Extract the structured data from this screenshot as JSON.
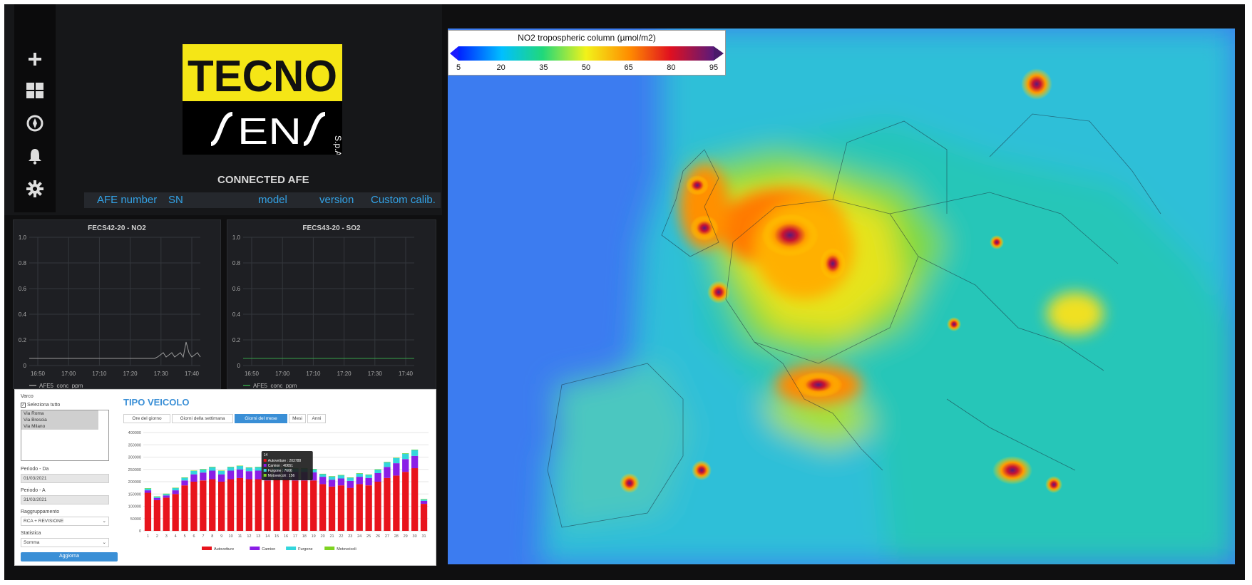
{
  "logo": {
    "line1": "TECNO",
    "line2": "SENS",
    "suffix": "S.p.A"
  },
  "sidebar": {
    "icons": [
      "plus-icon",
      "dashboard-icon",
      "compass-icon",
      "bell-icon",
      "gear-icon"
    ]
  },
  "connected": {
    "title": "CONNECTED AFE",
    "columns": [
      "AFE number",
      "SN",
      "model",
      "version",
      "Custom calib."
    ]
  },
  "panels": [
    {
      "title": "FECS42-20 - NO2",
      "legend": "AFE5_conc_ppm",
      "legend_color": "#9a9a9a",
      "y_ticks": [
        "1.0",
        "0.8",
        "0.6",
        "0.4",
        "0.2",
        "0"
      ],
      "x_ticks": [
        "16:50",
        "17:00",
        "17:10",
        "17:20",
        "17:30",
        "17:40"
      ]
    },
    {
      "title": "FECS43-20 - SO2",
      "legend": "AFE5_conc_ppm",
      "legend_color": "#37a24a",
      "y_ticks": [
        "1.0",
        "0.8",
        "0.6",
        "0.4",
        "0.2",
        "0"
      ],
      "x_ticks": [
        "16:50",
        "17:00",
        "17:10",
        "17:20",
        "17:30",
        "17:40"
      ]
    }
  ],
  "map": {
    "colorbar_title": "NO2 tropospheric column (µmol/m2)",
    "colorbar_ticks": [
      "5",
      "20",
      "35",
      "50",
      "65",
      "80",
      "95"
    ]
  },
  "report": {
    "varco_label": "Varco",
    "select_all": "Seleziona tutto",
    "varchi": [
      "Via Roma",
      "Via Brescia",
      "Via Milano"
    ],
    "periodo_da_label": "Periodo - Da",
    "periodo_da": "01/03/2021",
    "periodo_a_label": "Periodo - A",
    "periodo_a": "31/03/2021",
    "raggruppamento_label": "Raggruppamento",
    "raggruppamento": "RCA + REVISIONE",
    "statistica_label": "Statistica",
    "statistica": "Somma",
    "button": "Aggiorna",
    "chart_title": "TIPO VEICOLO",
    "tabs": [
      "Ore del giorno",
      "Giorni della settimana",
      "Giorni del mese",
      "Mesi",
      "Anni"
    ],
    "active_tab": 2,
    "tooltip": {
      "title": "14",
      "rows": [
        "Autovetture : 203788",
        "Camion : 40651",
        "Furgone : 7606",
        "Motoveicoli : 156"
      ]
    }
  },
  "chart_data": {
    "type": "bar",
    "stacked": true,
    "title": "TIPO VEICOLO",
    "categories": [
      "1",
      "2",
      "3",
      "4",
      "5",
      "6",
      "7",
      "8",
      "9",
      "10",
      "11",
      "12",
      "13",
      "14",
      "15",
      "16",
      "17",
      "18",
      "19",
      "20",
      "21",
      "22",
      "23",
      "24",
      "25",
      "26",
      "27",
      "28",
      "29",
      "30",
      "31"
    ],
    "series": [
      {
        "name": "Autovetture",
        "color": "#e8141c",
        "values": [
          155000,
          125000,
          135000,
          150000,
          185000,
          200000,
          205000,
          210000,
          200000,
          210000,
          215000,
          210000,
          210000,
          205000,
          212000,
          210000,
          205000,
          205000,
          205000,
          190000,
          180000,
          185000,
          175000,
          190000,
          185000,
          200000,
          215000,
          225000,
          240000,
          255000,
          110000
        ]
      },
      {
        "name": "Camion",
        "color": "#8a1ee6",
        "values": [
          10000,
          9000,
          9000,
          15000,
          20000,
          30000,
          32000,
          35000,
          30000,
          35000,
          35000,
          33000,
          35000,
          40651,
          35000,
          33000,
          35000,
          35000,
          33000,
          30000,
          28000,
          28000,
          28000,
          30000,
          30000,
          35000,
          45000,
          50000,
          52000,
          50000,
          12000
        ]
      },
      {
        "name": "Furgone",
        "color": "#33d6dc",
        "values": [
          8000,
          6000,
          7000,
          10000,
          12000,
          15000,
          14000,
          15000,
          15000,
          15000,
          15000,
          15000,
          15000,
          7606,
          15000,
          15000,
          15000,
          15000,
          14000,
          12000,
          14000,
          14000,
          14000,
          14000,
          14000,
          15000,
          20000,
          22000,
          23000,
          25000,
          7000
        ]
      },
      {
        "name": "Motoveicoli",
        "color": "#7ed321",
        "values": [
          300,
          300,
          300,
          300,
          300,
          300,
          300,
          300,
          300,
          300,
          300,
          300,
          300,
          156,
          300,
          300,
          300,
          300,
          300,
          300,
          300,
          300,
          300,
          300,
          300,
          300,
          300,
          300,
          300,
          300,
          300
        ]
      }
    ],
    "y_ticks": [
      "0",
      "50000",
      "100000",
      "150000",
      "200000",
      "250000",
      "300000",
      "350000",
      "400000"
    ],
    "ylim": [
      0,
      400000
    ],
    "legend": "bottom"
  }
}
